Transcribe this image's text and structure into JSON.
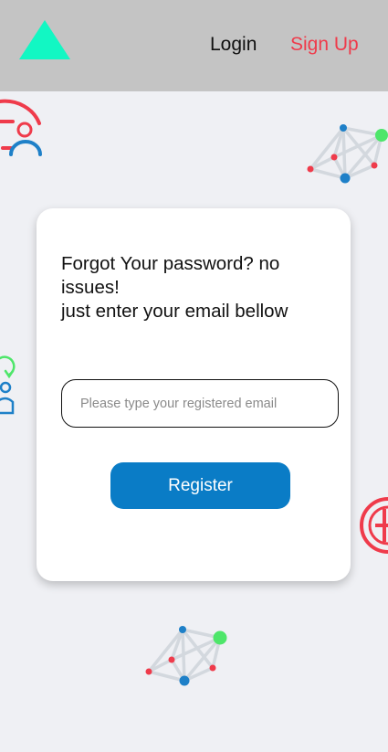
{
  "header": {
    "logo_icon": "triangle-logo",
    "logo_color": "#12f7c3",
    "login_label": "Login",
    "signup_label": "Sign Up",
    "signup_color": "#ef3b4b"
  },
  "background": {
    "color": "#eff0f4",
    "decorations": [
      "user-settings-icon",
      "network-graph-icon",
      "user-sync-icon",
      "add-circle-icon",
      "network-graph-icon"
    ]
  },
  "form": {
    "message_line1": "Forgot Your password? no",
    "message_line2": "issues!",
    "message_line3": "just enter your email bellow",
    "email_placeholder": "Please type your registered email",
    "email_value": "",
    "submit_label": "Register",
    "submit_color": "#0a7cc6"
  }
}
